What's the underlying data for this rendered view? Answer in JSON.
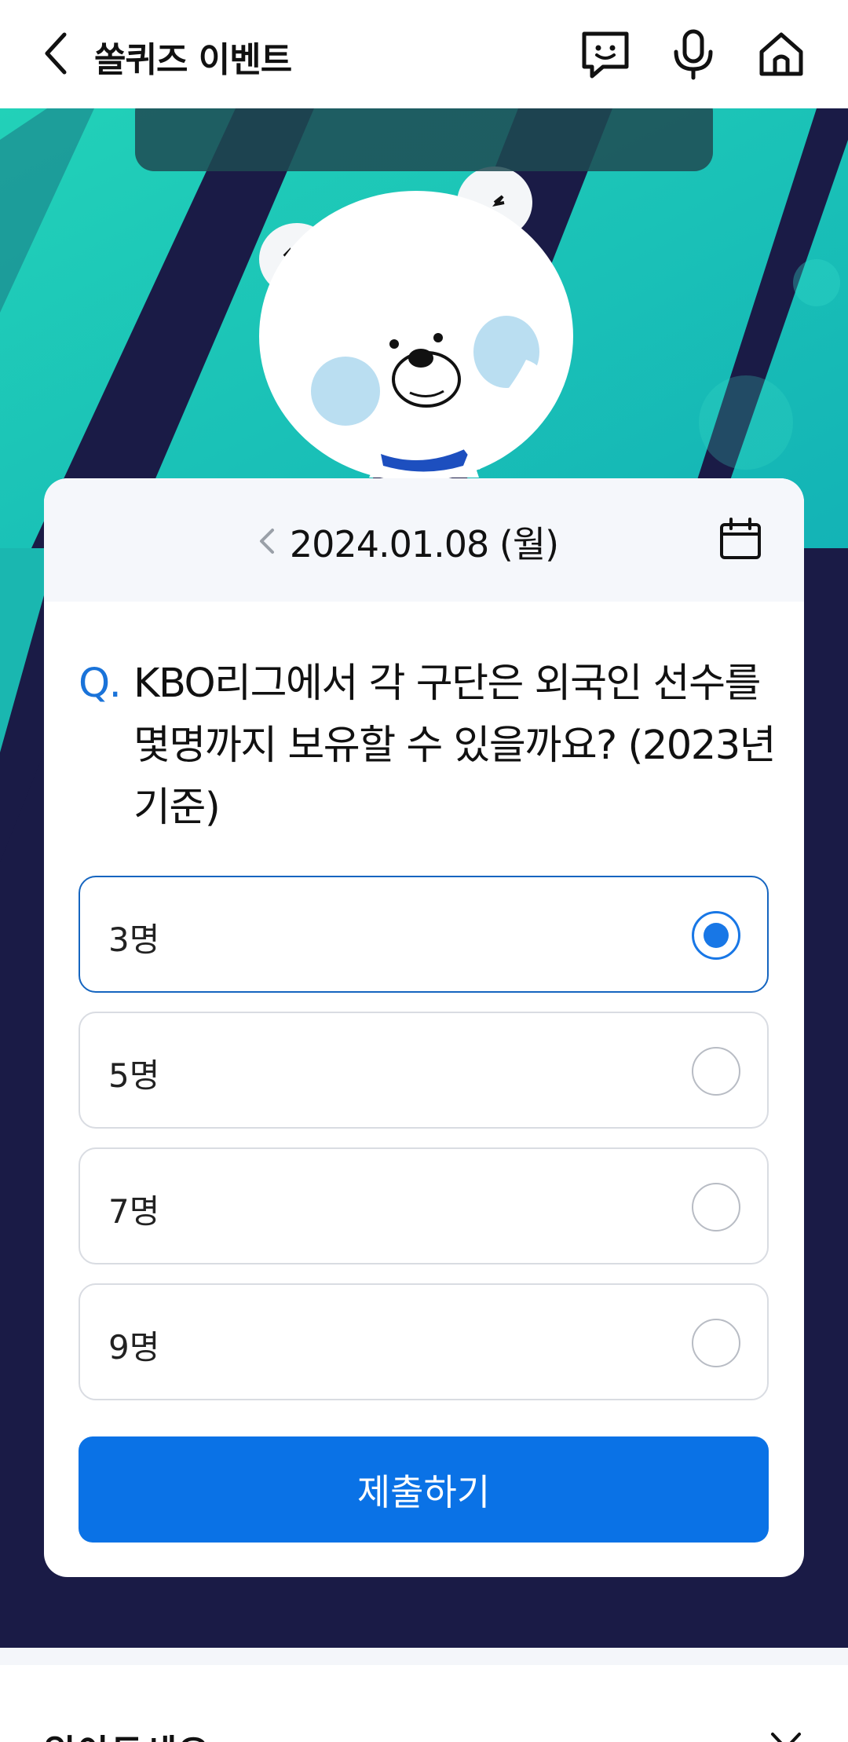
{
  "header": {
    "title": "쏠퀴즈 이벤트",
    "icons": [
      "back-chevron-icon",
      "chatbot-icon",
      "mic-icon",
      "home-icon"
    ]
  },
  "date_bar": {
    "date": "2024.01.08 (월)",
    "icons": [
      "prev-chevron-icon",
      "calendar-icon"
    ]
  },
  "quiz": {
    "question_mark": "Q.",
    "question": "KBO리그에서 각 구단은 외국인 선수를 몇명까지 보유할 수 있을까요? (2023년 기준)",
    "options": [
      {
        "label": "3명",
        "selected": true
      },
      {
        "label": "5명",
        "selected": false
      },
      {
        "label": "7명",
        "selected": false
      },
      {
        "label": "9명",
        "selected": false
      }
    ],
    "submit_label": "제출하기"
  },
  "bottom": {
    "title": "알아두세요"
  },
  "colors": {
    "accent": "#0a72e6",
    "hero_bg": "#1a1b46",
    "hero_teal": "#1fc6b4"
  }
}
